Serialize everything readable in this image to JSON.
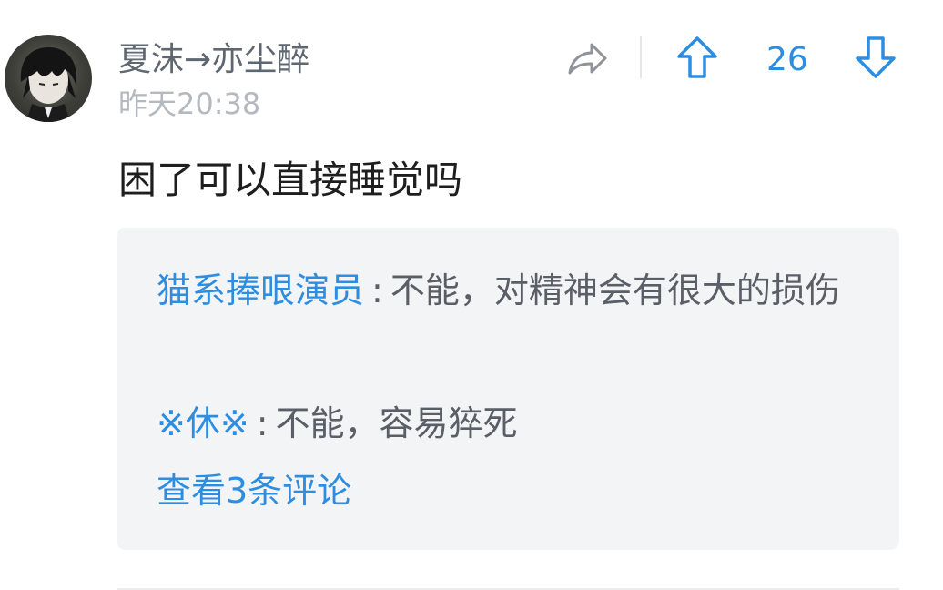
{
  "post": {
    "username": "夏沫→亦尘醉",
    "time": "昨天20:38",
    "text": "困了可以直接睡觉吗",
    "vote_count": "26"
  },
  "replies": [
    {
      "author": "猫系捧哏演员",
      "sep": ":",
      "text": "不能，对精神会有很大的损伤"
    },
    {
      "author": "※休※",
      "sep": ":",
      "text": "不能，容易猝死"
    }
  ],
  "view_more": "查看3条评论",
  "colors": {
    "accent": "#2d8de0",
    "username": "#5f6770",
    "timestamp": "#b4b9bf",
    "reply_bg": "#f3f4f6"
  },
  "icons": {
    "share": "share-icon",
    "upvote": "arrow-up-icon",
    "downvote": "arrow-down-icon"
  }
}
